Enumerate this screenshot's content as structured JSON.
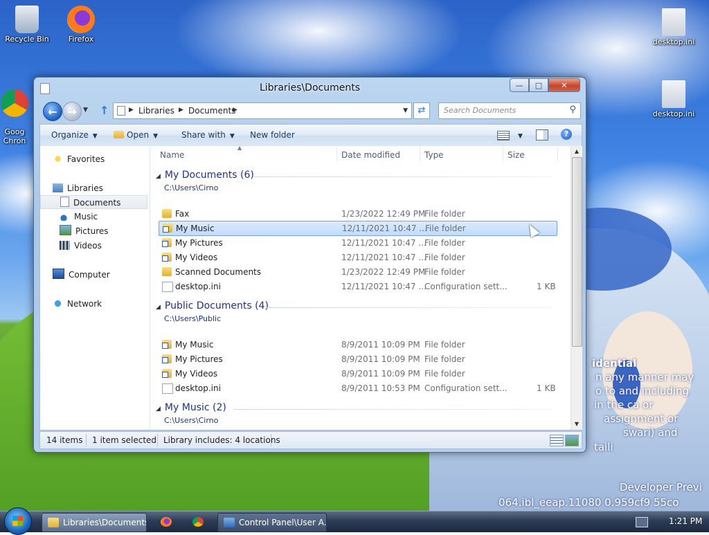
{
  "desktop": {
    "icons": [
      {
        "label": "Recycle Bin",
        "icon": "recycle-bin-icon"
      },
      {
        "label": "Firefox",
        "icon": "firefox-icon"
      },
      {
        "label": "Goog\nChron",
        "icon": "chrome-icon"
      },
      {
        "label": "desktop.ini",
        "icon": "settings-file-icon"
      },
      {
        "label": "desktop.ini",
        "icon": "settings-file-icon"
      }
    ],
    "overlay_lines": [
      "idential",
      "n any manner may",
      "o to and including",
      "in the ca or",
      "assignment or",
      "swari) and",
      "taili",
      "Developer Previ",
      "064.ibl_eeap.11080 0.959cf9 55co"
    ]
  },
  "window": {
    "title": "Libraries\\Documents",
    "buttons": {
      "minimize": "—",
      "maximize": "□",
      "close": "✕"
    },
    "address": {
      "crumbs": [
        "Libraries",
        "Documents"
      ]
    },
    "search_placeholder": "Search Documents",
    "toolbar": {
      "organize": "Organize",
      "open": "Open",
      "share_with": "Share with",
      "new_folder": "New folder"
    },
    "nav": {
      "favorites": "Favorites",
      "libraries": "Libraries",
      "documents": "Documents",
      "music": "Music",
      "pictures": "Pictures",
      "videos": "Videos",
      "computer": "Computer",
      "network": "Network"
    },
    "columns": {
      "name": "Name",
      "date": "Date modified",
      "type": "Type",
      "size": "Size"
    },
    "groups": [
      {
        "title": "My Documents (6)",
        "path": "C:\\Users\\Cirno",
        "rows": [
          {
            "name": "Fax",
            "date": "1/23/2022 12:49 PM",
            "type": "File folder",
            "size": "",
            "icon": "folder"
          },
          {
            "name": "My Music",
            "date": "12/11/2021 10:47 ...",
            "type": "File folder",
            "size": "",
            "icon": "shortcut"
          },
          {
            "name": "My Pictures",
            "date": "12/11/2021 10:47 ...",
            "type": "File folder",
            "size": "",
            "icon": "shortcut"
          },
          {
            "name": "My Videos",
            "date": "12/11/2021 10:47 ...",
            "type": "File folder",
            "size": "",
            "icon": "shortcut"
          },
          {
            "name": "Scanned Documents",
            "date": "1/23/2022 12:49 PM",
            "type": "File folder",
            "size": "",
            "icon": "folder"
          },
          {
            "name": "desktop.ini",
            "date": "12/11/2021 10:47 ...",
            "type": "Configuration sett...",
            "size": "1 KB",
            "icon": "ini"
          }
        ]
      },
      {
        "title": "Public Documents (4)",
        "path": "C:\\Users\\Public",
        "rows": [
          {
            "name": "My Music",
            "date": "8/9/2011 10:09 PM",
            "type": "File folder",
            "size": "",
            "icon": "shortcut"
          },
          {
            "name": "My Pictures",
            "date": "8/9/2011 10:09 PM",
            "type": "File folder",
            "size": "",
            "icon": "shortcut"
          },
          {
            "name": "My Videos",
            "date": "8/9/2011 10:09 PM",
            "type": "File folder",
            "size": "",
            "icon": "shortcut"
          },
          {
            "name": "desktop.ini",
            "date": "8/9/2011 10:53 PM",
            "type": "Configuration sett...",
            "size": "1 KB",
            "icon": "ini"
          }
        ]
      },
      {
        "title": "My Music (2)",
        "path": "C:\\Users\\Cirno",
        "rows": []
      }
    ],
    "status": {
      "items": "14 items",
      "selected": "1 item selected",
      "library": "Library includes: 4 locations"
    }
  },
  "taskbar": {
    "tasks": [
      {
        "label": "Libraries\\Documents",
        "icon": "folder-icon"
      },
      {
        "label": "",
        "icon": "firefox-icon"
      },
      {
        "label": "",
        "icon": "chrome-icon"
      },
      {
        "label": "Control Panel\\User A...",
        "icon": "control-panel-icon"
      }
    ],
    "clock": "1:21 PM"
  },
  "colors": {
    "accent": "#1e3287",
    "selection": "#c1dcfc"
  }
}
